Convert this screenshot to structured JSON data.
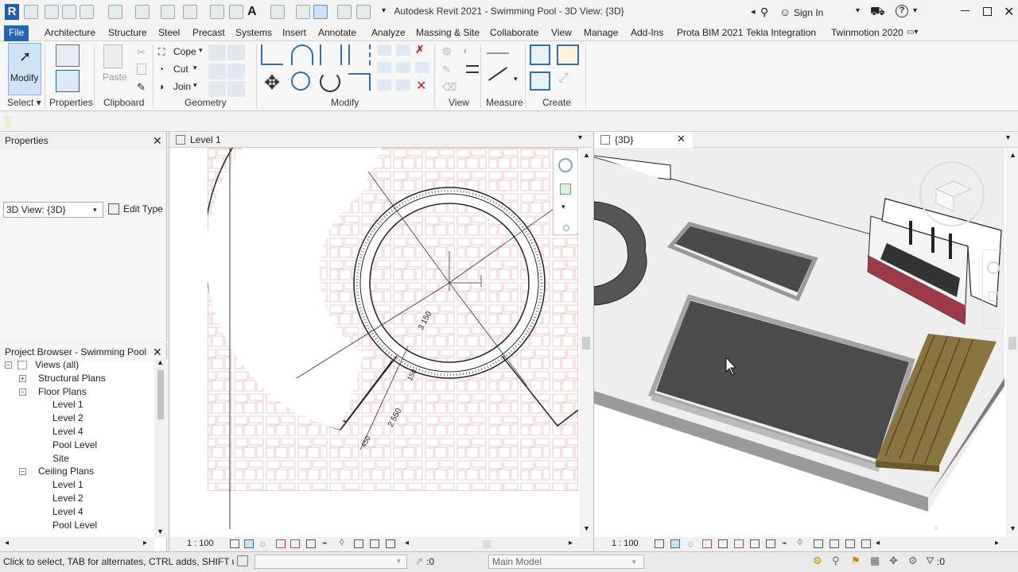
{
  "title": "Autodesk Revit 2021 - Swimming Pool - 3D View: {3D}",
  "titlebar": {
    "sign_in": "Sign In"
  },
  "menu": [
    "File",
    "Architecture",
    "Structure",
    "Steel",
    "Precast",
    "Systems",
    "Insert",
    "Annotate",
    "Analyze",
    "Massing & Site",
    "Collaborate",
    "View",
    "Manage",
    "Add-Ins",
    "Prota BIM 2021",
    "Tekla Integration",
    "Twinmotion 2020"
  ],
  "ribbon": {
    "modify": "Modify",
    "select": "Select",
    "properties": "Properties",
    "paste": "Paste",
    "clipboard": "Clipboard",
    "cope": "Cope",
    "cut": "Cut",
    "join": "Join",
    "geometry": "Geometry",
    "modify_panel": "Modify",
    "view_panel": "View",
    "measure": "Measure",
    "create": "Create"
  },
  "properties_panel": {
    "title": "Properties",
    "type_selector": "3D View: {3D}",
    "edit_type": "Edit Type"
  },
  "project_browser": {
    "title": "Project Browser - Swimming Pool",
    "items": [
      {
        "label": "Views (all)",
        "level": 0
      },
      {
        "label": "Structural Plans",
        "level": 1
      },
      {
        "label": "Floor Plans",
        "level": 1
      },
      {
        "label": "Level 1",
        "level": 2
      },
      {
        "label": "Level 2",
        "level": 2
      },
      {
        "label": "Level 4",
        "level": 2
      },
      {
        "label": "Pool Level",
        "level": 2
      },
      {
        "label": "Site",
        "level": 2
      },
      {
        "label": "Ceiling Plans",
        "level": 1
      },
      {
        "label": "Level 1",
        "level": 2
      },
      {
        "label": "Level 2",
        "level": 2
      },
      {
        "label": "Level 4",
        "level": 2
      },
      {
        "label": "Pool Level",
        "level": 2
      }
    ]
  },
  "views": {
    "left_tab": "Level 1",
    "right_tab": "{3D}",
    "left_scale": "1 : 100",
    "right_scale": "1 : 100",
    "dim1": "3 150",
    "dim2": "2 550",
    "dim3": "150",
    "dim4": "450"
  },
  "status": {
    "hint": "Click to select, TAB for alternates, CTRL adds, SHIFT unselects.",
    "zero1": ":0",
    "model": "Main Model",
    "zero2": ":0"
  },
  "colors": {
    "accent": "#1f66b6",
    "pool": "#4a4a4a",
    "wall": "#9c3b47",
    "deck": "#8a7440"
  }
}
